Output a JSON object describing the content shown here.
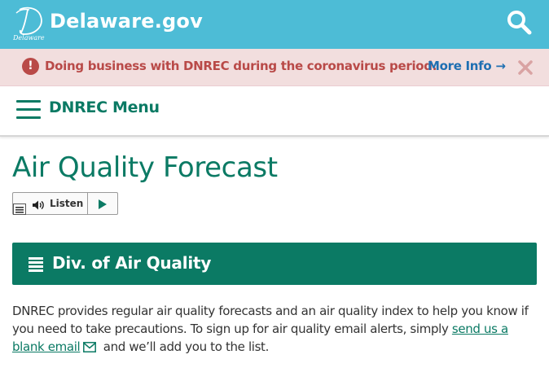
{
  "header": {
    "brand": "Delaware.gov",
    "logo_letter": "D",
    "logo_subtext": "Delaware",
    "search_icon": "search-icon",
    "background_color": "#4dbcd6"
  },
  "alert": {
    "icon": "exclamation-circle-icon",
    "icon_glyph": "!",
    "message": "Doing business with DNREC during the coronavirus period.",
    "link_label": "More Info",
    "link_arrow": "→",
    "close_glyph": "✕",
    "text_color": "#b94a48",
    "background_color": "#f2dede"
  },
  "menu": {
    "icon": "hamburger-icon",
    "label": "DNREC Menu",
    "color": "#0b7a64"
  },
  "page": {
    "title": "Air Quality Forecast"
  },
  "listen": {
    "label": "Listen",
    "menu_icon": "menu-icon",
    "sound_icon": "speaker-icon",
    "play_icon": "play-icon"
  },
  "panel": {
    "icon": "list-icon",
    "title": "Div. of Air Quality",
    "background_color": "#0b7a64"
  },
  "body": {
    "text_before": "DNREC provides regular air quality forecasts and an air quality index to help you know if you need to take precautions. To sign up for air quality email alerts, simply ",
    "link_text": "send us a blank email",
    "mail_icon": "envelope-icon",
    "text_after": " and we’ll add you to the list."
  }
}
